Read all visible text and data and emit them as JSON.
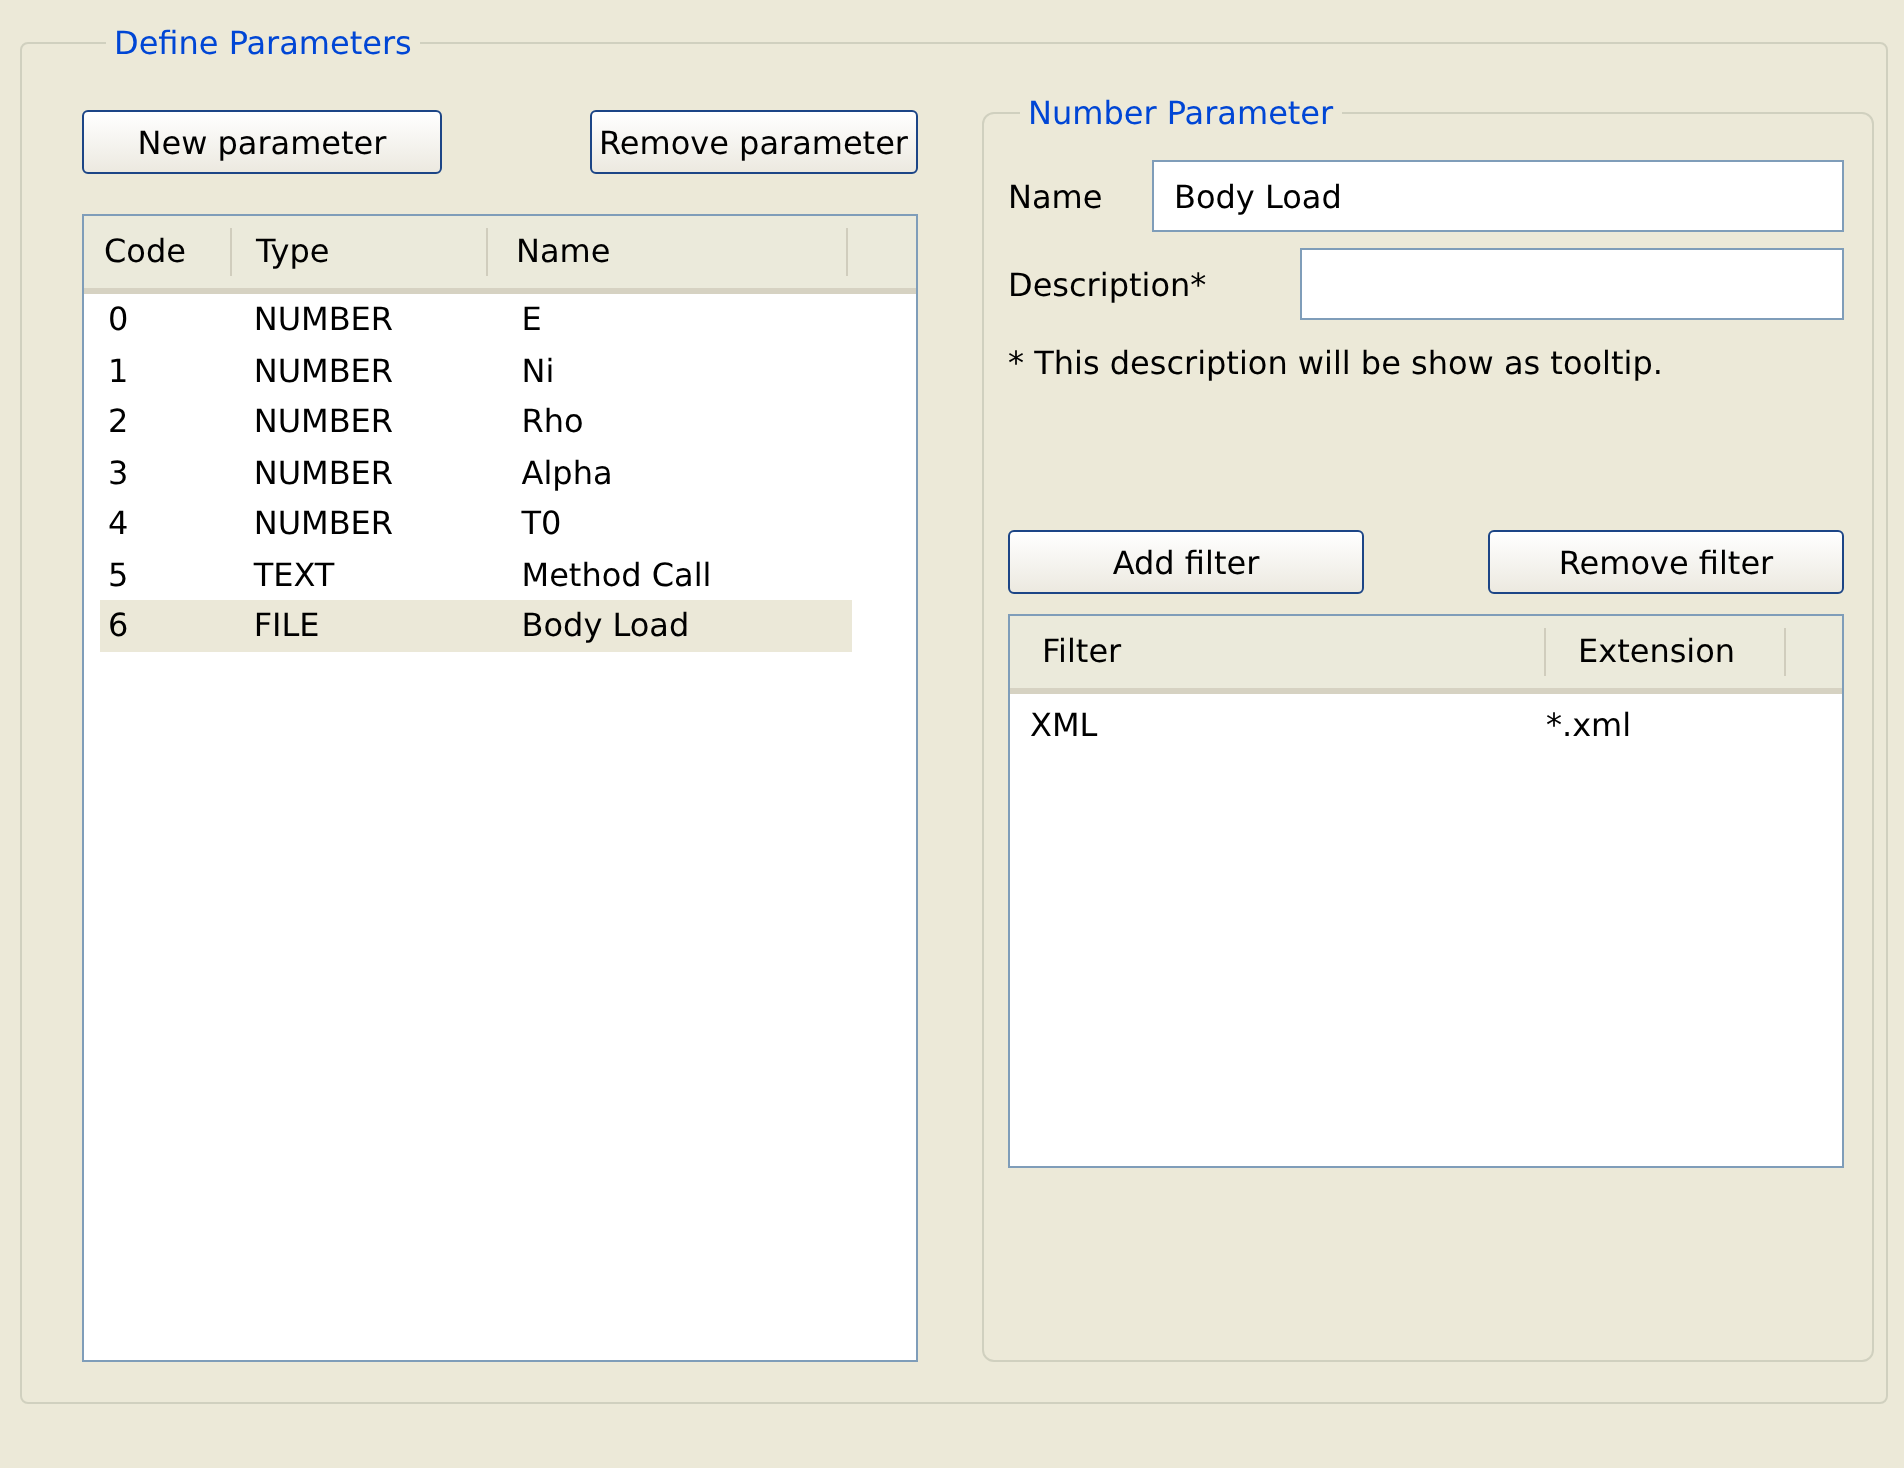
{
  "group": {
    "title": "Define Parameters"
  },
  "buttons": [
    {
      "label": "New parameter"
    },
    {
      "label": "Remove parameter"
    }
  ],
  "parameters_table": {
    "columns": [
      "Code",
      "Type",
      "Name"
    ],
    "rows": [
      {
        "code": "0",
        "type": "NUMBER",
        "name": "E",
        "selected": false
      },
      {
        "code": "1",
        "type": "NUMBER",
        "name": "Ni",
        "selected": false
      },
      {
        "code": "2",
        "type": "NUMBER",
        "name": "Rho",
        "selected": false
      },
      {
        "code": "3",
        "type": "NUMBER",
        "name": "Alpha",
        "selected": false
      },
      {
        "code": "4",
        "type": "NUMBER",
        "name": "T0",
        "selected": false
      },
      {
        "code": "5",
        "type": "TEXT",
        "name": "Method Call",
        "selected": false
      },
      {
        "code": "6",
        "type": "FILE",
        "name": "Body Load",
        "selected": true
      }
    ]
  },
  "detail": {
    "title": "Number Parameter",
    "name_label": "Name",
    "name_value": "Body Load",
    "description_label": "Description*",
    "note": "* This description will be show as tooltip.",
    "filter_buttons": [
      {
        "label": "Add filter"
      },
      {
        "label": "Remove filter"
      }
    ],
    "filter_table": {
      "columns": [
        "Filter",
        "Extension"
      ],
      "rows": [
        {
          "filter": "XML",
          "extension": "*.xml"
        }
      ]
    }
  }
}
